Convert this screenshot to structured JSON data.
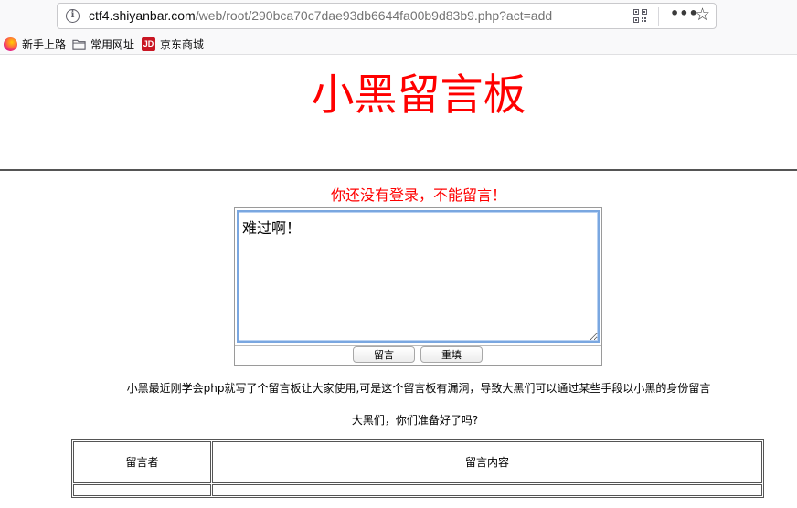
{
  "browser": {
    "url_host": "ctf4.shiyanbar.com",
    "url_path": "/web/root/290bca70c7dae93db6644fa00b9d83b9.php?act=add",
    "bookmarks": [
      {
        "label": "新手上路",
        "icon": "firefox-icon"
      },
      {
        "label": "常用网址",
        "icon": "folder-icon"
      },
      {
        "label": "京东商城",
        "icon": "jd-icon",
        "icon_text": "JD"
      }
    ]
  },
  "page": {
    "title": "小黑留言板",
    "notice": "你还没有登录，不能留言！",
    "form": {
      "message_value": "难过啊！",
      "submit_label": "留言",
      "reset_label": "重填"
    },
    "description": "小黑最近刚学会php就写了个留言板让大家使用,可是这个留言板有漏洞，导致大黑们可以通过某些手段以小黑的身份留言",
    "question": "大黑们，你们准备好了吗?",
    "table": {
      "headers": [
        "留言者",
        "留言内容"
      ]
    }
  },
  "colors": {
    "title": "#ff0000",
    "notice": "#ff0000",
    "textarea_focus": "#7aa7e0"
  }
}
